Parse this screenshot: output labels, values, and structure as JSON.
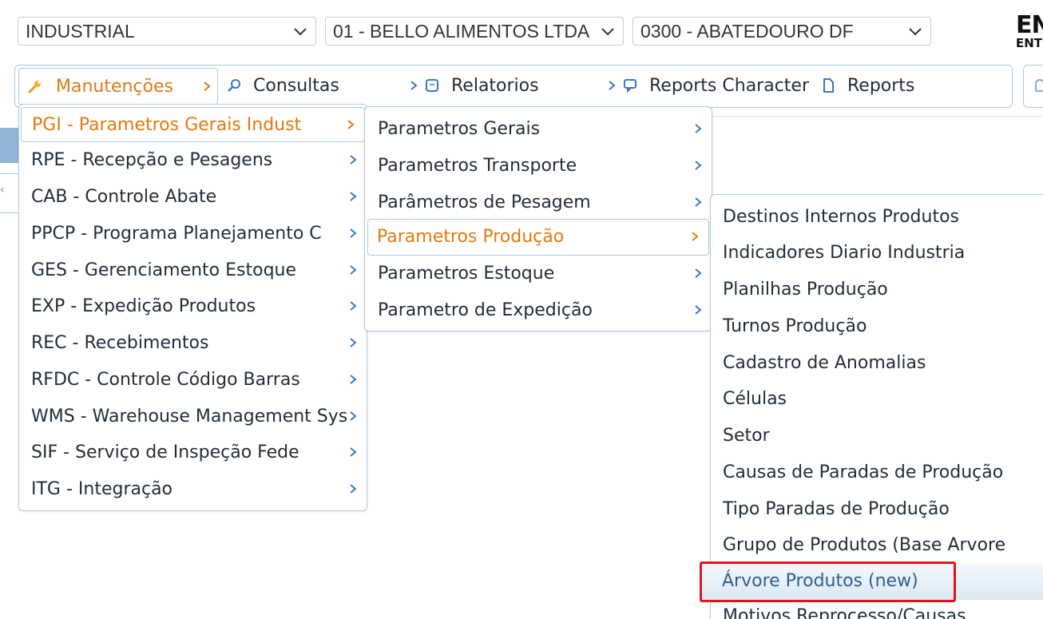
{
  "filters": {
    "area": "INDUSTRIAL",
    "company": "01 - BELLO ALIMENTOS LTDA",
    "plant": "0300 - ABATEDOURO DF"
  },
  "brand": {
    "line1": "EN",
    "line2": "ENT"
  },
  "menubar": {
    "items": [
      {
        "label": "Manutenções",
        "icon": "wrench-icon"
      },
      {
        "label": "Consultas",
        "icon": "search-icon"
      },
      {
        "label": "Relatorios",
        "icon": "report-icon"
      },
      {
        "label": "Reports Character",
        "icon": "chat-icon"
      },
      {
        "label": "Reports",
        "icon": "document-icon"
      }
    ]
  },
  "menu_level1": [
    {
      "label": "PGI - Parametros Gerais Indust"
    },
    {
      "label": "RPE - Recepção e Pesagens"
    },
    {
      "label": "CAB - Controle Abate"
    },
    {
      "label": "PPCP - Programa Planejamento C"
    },
    {
      "label": "GES - Gerenciamento Estoque"
    },
    {
      "label": "EXP - Expedição Produtos"
    },
    {
      "label": "REC - Recebimentos"
    },
    {
      "label": "RFDC - Controle Código Barras"
    },
    {
      "label": "WMS - Warehouse Management Sys"
    },
    {
      "label": "SIF - Serviço de Inspeção Fede"
    },
    {
      "label": "ITG - Integração"
    }
  ],
  "menu_level2": [
    {
      "label": "Parametros Gerais"
    },
    {
      "label": "Parametros Transporte"
    },
    {
      "label": "Parâmetros de Pesagem"
    },
    {
      "label": "Parametros Produção"
    },
    {
      "label": "Parametros Estoque"
    },
    {
      "label": "Parametro de Expedição"
    }
  ],
  "menu_level3": [
    {
      "label": "Destinos Internos Produtos"
    },
    {
      "label": "Indicadores Diario Industria"
    },
    {
      "label": "Planilhas Produção"
    },
    {
      "label": "Turnos Produção"
    },
    {
      "label": "Cadastro de Anomalias"
    },
    {
      "label": "Células"
    },
    {
      "label": "Setor"
    },
    {
      "label": "Causas de Paradas de Produção"
    },
    {
      "label": "Tipo Paradas de Produção"
    },
    {
      "label": "Grupo de Produtos (Base Arvore"
    },
    {
      "label": "Árvore Produtos (new)"
    },
    {
      "label": "Motivos Reprocesso/Causas"
    }
  ],
  "colors": {
    "accent": "#e07a10",
    "border": "#aacbe0",
    "highlight_box": "#e3131b"
  }
}
